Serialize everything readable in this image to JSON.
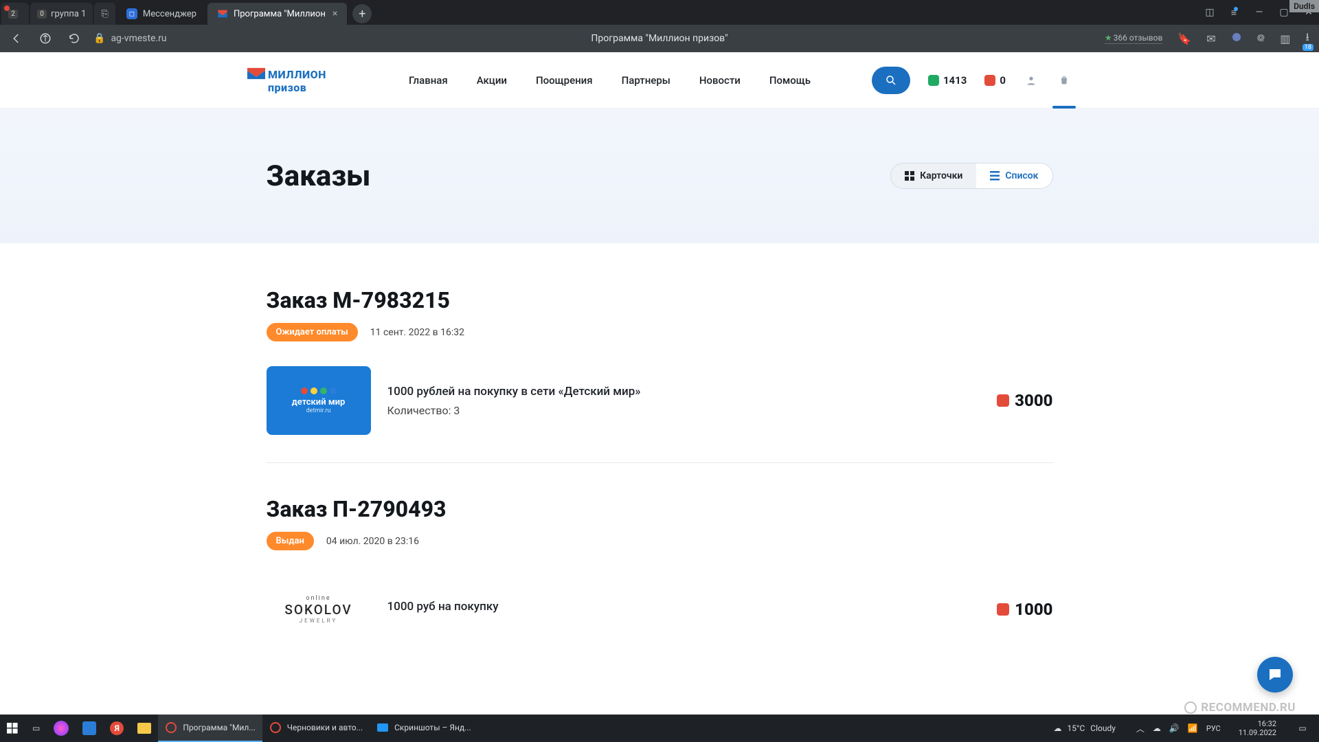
{
  "browser": {
    "tabs": {
      "pin1_badge": "2",
      "pin2_badge": "0",
      "pin2_label": "группа 1",
      "tab_messenger": "Мессенджер",
      "tab_active": "Программа \"Миллион"
    },
    "url": "ag-vmeste.ru",
    "page_title_center": "Программа \"Миллион призов\"",
    "reviews_text": "366 отзывов",
    "download_count": "18",
    "dudis_label": "DudIs"
  },
  "site": {
    "logo_word1": "МИЛЛИОН",
    "logo_word2": "призов",
    "nav": [
      "Главная",
      "Акции",
      "Поощрения",
      "Партнеры",
      "Новости",
      "Помощь"
    ],
    "points_green": "1413",
    "points_red": "0"
  },
  "hero": {
    "title": "Заказы",
    "view_cards": "Карточки",
    "view_list": "Список"
  },
  "orders": [
    {
      "title": "Заказ М-7983215",
      "status": "Ожидает оплаты",
      "date": "11 сент. 2022 в 16:32",
      "thumb_brand_line1": "детский мир",
      "thumb_brand_line2": "detmir.ru",
      "desc": "1000 рублей на покупку в сети «Детский мир»",
      "qty": "Количество: 3",
      "price": "3000"
    },
    {
      "title": "Заказ П-2790493",
      "status": "Выдан",
      "date": "04 июл. 2020 в 23:16",
      "thumb_sokolov_top": "online",
      "thumb_sokolov_main": "SOKOLOV",
      "thumb_sokolov_bottom": "JEWELRY",
      "desc": "1000 руб на покупку",
      "price": "1000"
    }
  ],
  "watermark": "RECOMMEND.RU",
  "taskbar": {
    "apps": [
      {
        "label": "Программа \"Мил...",
        "color": "#e44b3b"
      },
      {
        "label": "Черновики и авто...",
        "color": "#e44b3b"
      },
      {
        "label": "Скриншоты – Янд...",
        "color": "#2196f3"
      }
    ],
    "weather_temp": "15°C",
    "weather_cond": "Cloudy",
    "time": "16:32",
    "date": "11.09.2022"
  }
}
